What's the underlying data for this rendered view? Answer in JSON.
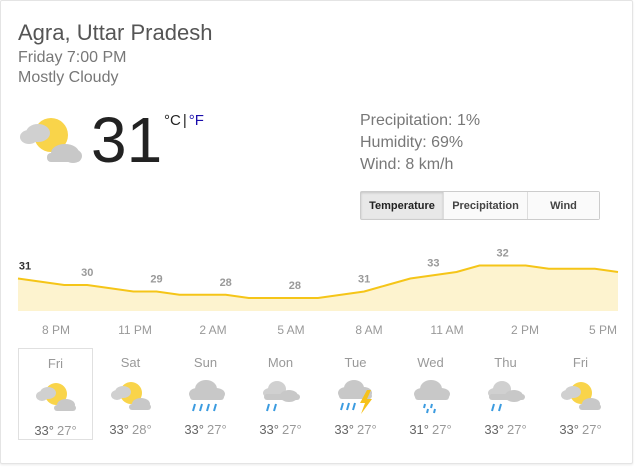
{
  "location": "Agra, Uttar Pradesh",
  "datetime": "Friday 7:00 PM",
  "condition": "Mostly Cloudy",
  "current": {
    "icon": "partly-cloudy-icon",
    "temperature": "31",
    "unit_c": "°C",
    "unit_sep": "|",
    "unit_f": "°F"
  },
  "stats": {
    "precipitation": "Precipitation: 1%",
    "humidity": "Humidity: 69%",
    "wind": "Wind: 8 km/h"
  },
  "tabs": [
    {
      "label": "Temperature",
      "active": true
    },
    {
      "label": "Precipitation",
      "active": false
    },
    {
      "label": "Wind",
      "active": false
    }
  ],
  "colors": {
    "line": "#f5c518",
    "fill": "#fdf3cf",
    "sun": "#f9d44a",
    "cloud": "#c8c8c8",
    "rain": "#3b9be0",
    "bolt": "#f6c21a"
  },
  "chart_data": {
    "type": "area",
    "series": [
      {
        "values": [
          31,
          30.5,
          30,
          30,
          29.5,
          29,
          29,
          28.5,
          28.5,
          28.5,
          28,
          28,
          28,
          28,
          28.5,
          29,
          30,
          31,
          31.5,
          32,
          33,
          33,
          33,
          32.5,
          32.5,
          32.5,
          32
        ]
      }
    ],
    "data_labels": [
      {
        "index": 0,
        "label": "31"
      },
      {
        "index": 3,
        "label": "30"
      },
      {
        "index": 6,
        "label": "29"
      },
      {
        "index": 9,
        "label": "28"
      },
      {
        "index": 12,
        "label": "28"
      },
      {
        "index": 15,
        "label": "31"
      },
      {
        "index": 18,
        "label": "33"
      },
      {
        "index": 21,
        "label": "32"
      }
    ],
    "ylim": [
      26,
      34
    ]
  },
  "times": [
    "8 PM",
    "11 PM",
    "2 AM",
    "5 AM",
    "8 AM",
    "11 AM",
    "2 PM",
    "5 PM"
  ],
  "forecast": [
    {
      "day": "Fri",
      "icon": "partly-cloudy-icon",
      "hi": "33°",
      "lo": "27°"
    },
    {
      "day": "Sat",
      "icon": "partly-cloudy-icon",
      "hi": "33°",
      "lo": "28°"
    },
    {
      "day": "Sun",
      "icon": "rain-icon",
      "hi": "33°",
      "lo": "27°"
    },
    {
      "day": "Mon",
      "icon": "scattered-showers-icon",
      "hi": "33°",
      "lo": "27°"
    },
    {
      "day": "Tue",
      "icon": "thunderstorm-icon",
      "hi": "33°",
      "lo": "27°"
    },
    {
      "day": "Wed",
      "icon": "light-rain-icon",
      "hi": "31°",
      "lo": "27°"
    },
    {
      "day": "Thu",
      "icon": "scattered-showers-icon",
      "hi": "33°",
      "lo": "27°"
    },
    {
      "day": "Fri",
      "icon": "partly-cloudy-icon",
      "hi": "33°",
      "lo": "27°"
    }
  ]
}
